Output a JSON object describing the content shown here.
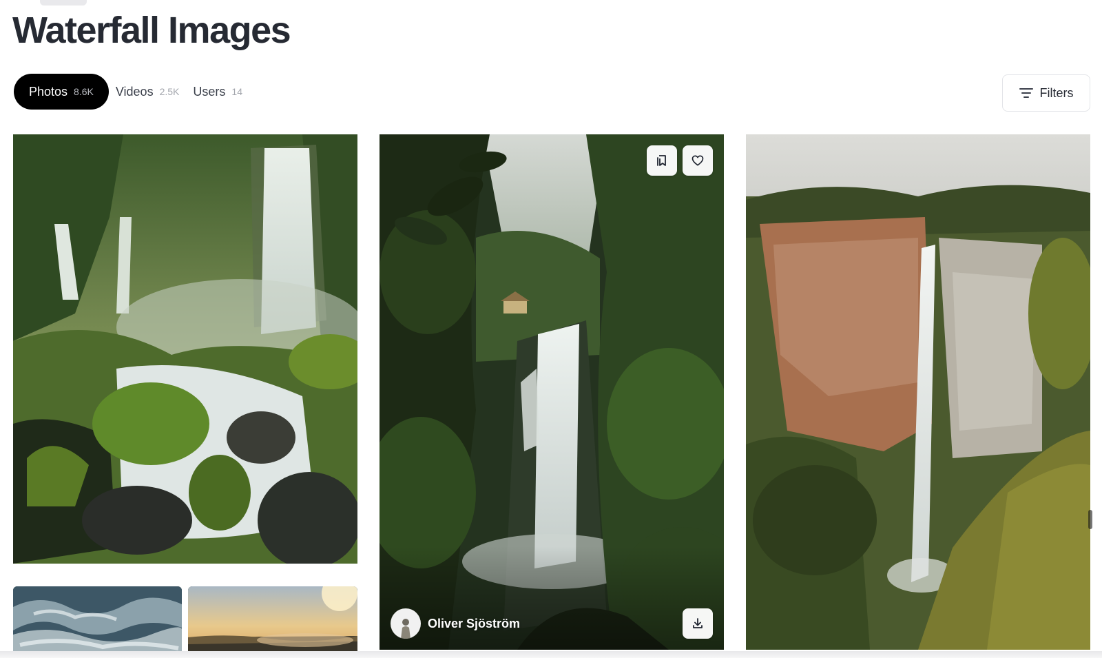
{
  "page": {
    "title": "Waterfall Images"
  },
  "tabs": [
    {
      "label": "Photos",
      "count": "8.6K",
      "active": true
    },
    {
      "label": "Videos",
      "count": "2.5K",
      "active": false
    },
    {
      "label": "Users",
      "count": "14",
      "active": false
    }
  ],
  "filters": {
    "label": "Filters",
    "icon": "filter-lines-icon"
  },
  "photos": [
    {
      "subject": "waterfall-mossy-rocks"
    },
    {
      "subject": "waterfall-jungle-hut",
      "author": "Oliver Sjöström",
      "actions": [
        "collection-icon",
        "heart-icon",
        "download-icon"
      ]
    },
    {
      "subject": "waterfall-cliff-tall"
    },
    {
      "subject": "rapids-water"
    },
    {
      "subject": "sunset-landscape"
    }
  ],
  "colors": {
    "active_tab_bg": "#000000",
    "title": "#262a33",
    "count_muted": "#a3a6ad"
  }
}
